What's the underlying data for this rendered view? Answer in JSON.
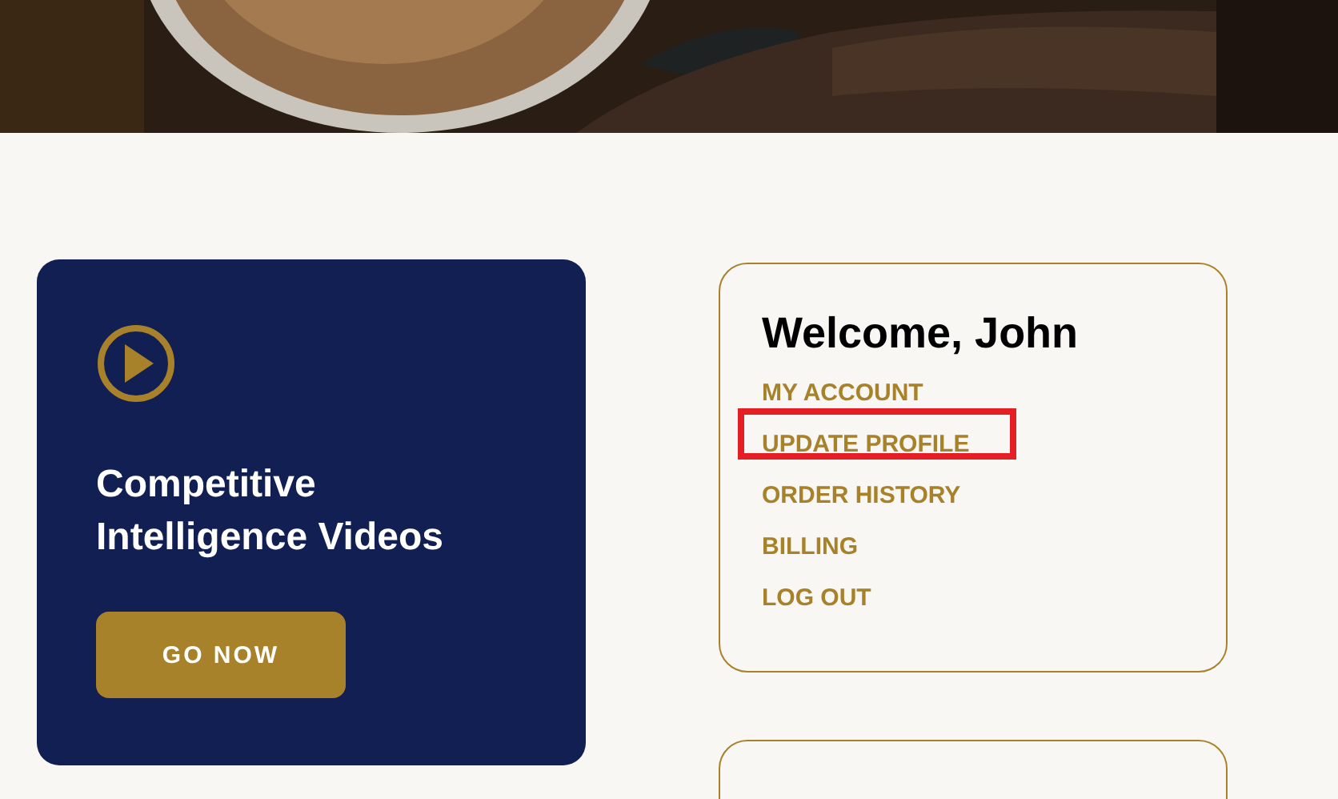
{
  "video_card": {
    "title": "Competitive Intelligence Videos",
    "button": "GO NOW"
  },
  "account_card": {
    "heading": "Welcome, John",
    "links": [
      {
        "label": "MY ACCOUNT",
        "highlighted": false
      },
      {
        "label": "UPDATE PROFILE",
        "highlighted": true
      },
      {
        "label": "ORDER HISTORY",
        "highlighted": false
      },
      {
        "label": "BILLING",
        "highlighted": false
      },
      {
        "label": "LOG OUT",
        "highlighted": false
      }
    ]
  }
}
